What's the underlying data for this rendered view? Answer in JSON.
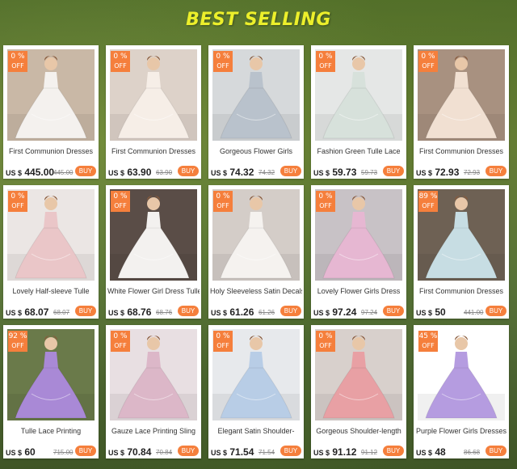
{
  "header": {
    "title": "BEST SELLING"
  },
  "products": [
    {
      "name": "First Communion Dresses",
      "badge_pct": "0 %",
      "badge_off": "OFF",
      "currency": "US $",
      "price": "445.00",
      "orig": "445.00",
      "buy": "BUY",
      "bg": "#c9b8a6",
      "dress": "#f4f1ee"
    },
    {
      "name": "First Communion Dresses",
      "badge_pct": "0 %",
      "badge_off": "OFF",
      "currency": "US $",
      "price": "63.90",
      "orig": "63.90",
      "buy": "BUY",
      "bg": "#ddd2c9",
      "dress": "#f6eee7"
    },
    {
      "name": "Gorgeous Flower Girls",
      "badge_pct": "0 %",
      "badge_off": "OFF",
      "currency": "US $",
      "price": "74.32",
      "orig": "74.32",
      "buy": "BUY",
      "bg": "#d6d9db",
      "dress": "#b9c2cc"
    },
    {
      "name": "Fashion Green Tulle Lace",
      "badge_pct": "0 %",
      "badge_off": "OFF",
      "currency": "US $",
      "price": "59.73",
      "orig": "59.73",
      "buy": "BUY",
      "bg": "#e5e7e6",
      "dress": "#d7e1db"
    },
    {
      "name": "First Communion Dresses",
      "badge_pct": "0 %",
      "badge_off": "OFF",
      "currency": "US $",
      "price": "72.93",
      "orig": "72.93",
      "buy": "BUY",
      "bg": "#a89180",
      "dress": "#f1e0d2"
    },
    {
      "name": "Lovely Half-sleeve Tulle",
      "badge_pct": "0 %",
      "badge_off": "OFF",
      "currency": "US $",
      "price": "68.07",
      "orig": "68.07",
      "buy": "BUY",
      "bg": "#ebe6e4",
      "dress": "#eac6c8"
    },
    {
      "name": "White Flower Girl Dress Tulle",
      "badge_pct": "0 %",
      "badge_off": "OFF",
      "currency": "US $",
      "price": "68.76",
      "orig": "68.76",
      "buy": "BUY",
      "bg": "#5a4d47",
      "dress": "#f3f1ef"
    },
    {
      "name": "Holy Sleeveless Satin Decals",
      "badge_pct": "0 %",
      "badge_off": "OFF",
      "currency": "US $",
      "price": "61.26",
      "orig": "61.26",
      "buy": "BUY",
      "bg": "#d4cdc8",
      "dress": "#f5f2ef"
    },
    {
      "name": "Lovely Flower Girls Dress",
      "badge_pct": "0 %",
      "badge_off": "OFF",
      "currency": "US $",
      "price": "97.24",
      "orig": "97.24",
      "buy": "BUY",
      "bg": "#c8c2c6",
      "dress": "#e6b7d2"
    },
    {
      "name": "First Communion Dresses",
      "badge_pct": "89 %",
      "badge_off": "OFF",
      "currency": "US $",
      "price": "50",
      "orig": "441.00",
      "buy": "BUY",
      "bg": "#6e6154",
      "dress": "#c7dde3"
    },
    {
      "name": "Tulle Lace Printing",
      "badge_pct": "92 %",
      "badge_off": "OFF",
      "currency": "US $",
      "price": "60",
      "orig": "715.00",
      "buy": "BUY",
      "bg": "#6a7a4a",
      "dress": "#a989d6"
    },
    {
      "name": "Gauze Lace Printing Sling",
      "badge_pct": "0 %",
      "badge_off": "OFF",
      "currency": "US $",
      "price": "70.84",
      "orig": "70.84",
      "buy": "BUY",
      "bg": "#e8dfe2",
      "dress": "#dcb7c8"
    },
    {
      "name": "Elegant Satin Shoulder-",
      "badge_pct": "0 %",
      "badge_off": "OFF",
      "currency": "US $",
      "price": "71.54",
      "orig": "71.54",
      "buy": "BUY",
      "bg": "#e7e9ec",
      "dress": "#b8cde6"
    },
    {
      "name": "Gorgeous Shoulder-length",
      "badge_pct": "0 %",
      "badge_off": "OFF",
      "currency": "US $",
      "price": "91.12",
      "orig": "91.12",
      "buy": "BUY",
      "bg": "#d8d0cc",
      "dress": "#e8a0a4"
    },
    {
      "name": "Purple Flower Girls Dresses",
      "badge_pct": "45 %",
      "badge_off": "OFF",
      "currency": "US $",
      "price": "48",
      "orig": "86.68",
      "buy": "BUY",
      "bg": "#ffffff",
      "dress": "#b59ce0"
    }
  ]
}
